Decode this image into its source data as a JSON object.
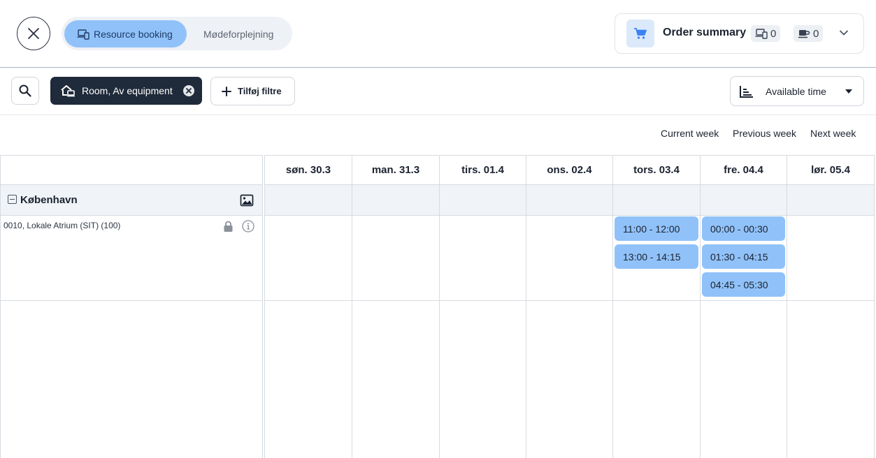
{
  "header": {
    "tabs": [
      {
        "label": "Resource booking",
        "active": true
      },
      {
        "label": "Mødeforplejning",
        "active": false
      }
    ],
    "order_summary": {
      "title": "Order summary",
      "equipment_count": "0",
      "catering_count": "0"
    }
  },
  "filters": {
    "active_chip": "Room, Av equipment",
    "add_filter_label": "Tilføj filtre",
    "sort_label": "Available time"
  },
  "week_nav": {
    "current": "Current week",
    "previous": "Previous week",
    "next": "Next week"
  },
  "days": [
    "søn. 30.3",
    "man. 31.3",
    "tirs. 01.4",
    "ons. 02.4",
    "tors. 03.4",
    "fre. 04.4",
    "lør. 05.4"
  ],
  "group": {
    "name": "København"
  },
  "resource": {
    "name": "0010, Lokale Atrium (SIT) (100)"
  },
  "slots": {
    "tors": [
      "11:00 - 12:00",
      "13:00 - 14:15"
    ],
    "fre": [
      "00:00 - 00:30",
      "01:30 - 04:15",
      "04:45 - 05:30"
    ]
  },
  "colors": {
    "accent": "#90c2f9",
    "chip_dark": "#1f2a3a",
    "group_bg": "#f0f3f7"
  }
}
